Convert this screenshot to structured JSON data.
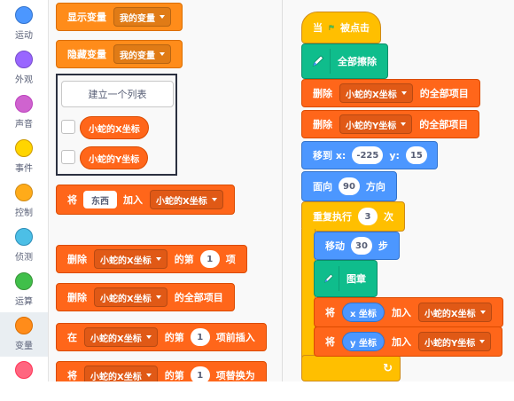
{
  "categories": [
    {
      "label": "运动",
      "color": "#4c97ff"
    },
    {
      "label": "外观",
      "color": "#9966ff"
    },
    {
      "label": "声音",
      "color": "#cf63cf"
    },
    {
      "label": "事件",
      "color": "#ffd500"
    },
    {
      "label": "控制",
      "color": "#ffab19"
    },
    {
      "label": "侦测",
      "color": "#4cbfe6"
    },
    {
      "label": "运算",
      "color": "#40bf4a"
    },
    {
      "label": "变量",
      "color": "#ff8c1a"
    },
    {
      "label": "",
      "color": "#ff6680"
    }
  ],
  "palette": {
    "show_var": {
      "label": "显示变量",
      "var": "我的变量"
    },
    "hide_var": {
      "label": "隐藏变量",
      "var": "我的变量"
    },
    "make_list": "建立一个列表",
    "lists": [
      "小蛇的X坐标",
      "小蛇的Y坐标"
    ],
    "add_to": {
      "prefix": "将",
      "value": "东西",
      "middle": "加入",
      "list": "小蛇的X坐标"
    },
    "delete_item": {
      "prefix": "删除",
      "list": "小蛇的X坐标",
      "mid": "的第",
      "num": "1",
      "suffix": "项"
    },
    "delete_all": {
      "prefix": "删除",
      "list": "小蛇的X坐标",
      "suffix": "的全部项目"
    },
    "insert_at": {
      "prefix": "在",
      "list": "小蛇的X坐标",
      "mid": "的第",
      "num": "1",
      "suffix": "项前插入"
    },
    "replace_at": {
      "prefix": "将",
      "list": "小蛇的X坐标",
      "mid": "的第",
      "num": "1",
      "suffix": "项替换为"
    }
  },
  "script": {
    "hat": {
      "prefix": "当",
      "suffix": "被点击"
    },
    "erase_all": "全部擦除",
    "del_all_x": {
      "prefix": "删除",
      "list": "小蛇的X坐标",
      "suffix": "的全部项目"
    },
    "del_all_y": {
      "prefix": "删除",
      "list": "小蛇的Y坐标",
      "suffix": "的全部项目"
    },
    "goto": {
      "label": "移到 x:",
      "x": "-225",
      "ylabel": "y:",
      "y": "15"
    },
    "point": {
      "label": "面向",
      "deg": "90",
      "suffix": "方向"
    },
    "repeat": {
      "label": "重复执行",
      "times": "3",
      "suffix": "次"
    },
    "move": {
      "label": "移动",
      "steps": "30",
      "suffix": "步"
    },
    "stamp": "图章",
    "add_x": {
      "prefix": "将",
      "reporter": "x 坐标",
      "middle": "加入",
      "list": "小蛇的X坐标"
    },
    "add_y": {
      "prefix": "将",
      "reporter": "y 坐标",
      "middle": "加入",
      "list": "小蛇的Y坐标"
    },
    "loop_arrow": "↻"
  }
}
